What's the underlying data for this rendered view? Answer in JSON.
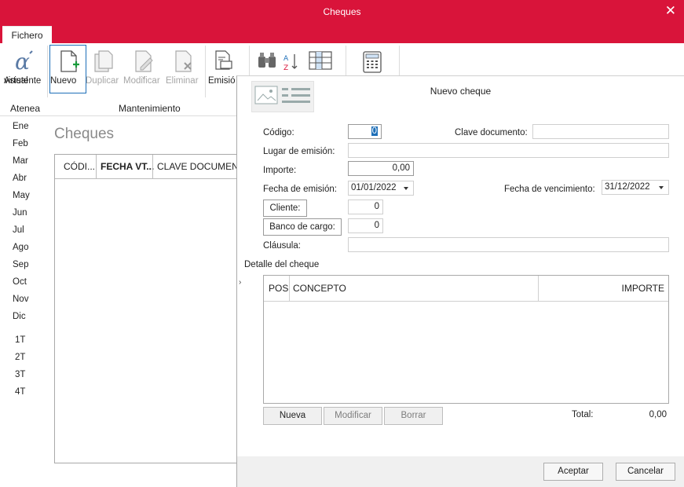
{
  "window": {
    "title": "Cheques",
    "close_glyph": "✕"
  },
  "tabs": [
    {
      "label": "Fichero"
    }
  ],
  "ribbon": {
    "asistente": {
      "line1": "Asistente",
      "line2": "virtual",
      "icon": "alpha-icon"
    },
    "nuevo": "Nuevo",
    "duplicar": "Duplicar",
    "modificar": "Modificar",
    "eliminar": "Eliminar",
    "emision": "Emisió",
    "group_atenea": "Atenea",
    "group_mantenimiento": "Mantenimiento"
  },
  "months": [
    "Ene",
    "Feb",
    "Mar",
    "Abr",
    "May",
    "Jun",
    "Jul",
    "Ago",
    "Sep",
    "Oct",
    "Nov",
    "Dic",
    "1T",
    "2T",
    "3T",
    "4T"
  ],
  "list": {
    "title": "Cheques",
    "columns": [
      "CÓDI...",
      "FECHA VT...",
      "CLAVE DOCUMENT"
    ]
  },
  "dialog": {
    "title": "Nuevo cheque",
    "codigo_label": "Código:",
    "codigo_value": "0",
    "clave_doc_label": "Clave documento:",
    "clave_doc_value": "",
    "lugar_label": "Lugar de emisión:",
    "lugar_value": "",
    "importe_label": "Importe:",
    "importe_value": "0,00",
    "fecha_emision_label": "Fecha de emisión:",
    "fecha_emision_value": "01/01/2022",
    "fecha_venc_label": "Fecha de vencimiento:",
    "fecha_venc_value": "31/12/2022",
    "cliente_label": "Cliente:",
    "cliente_value": "0",
    "banco_label": "Banco de cargo:",
    "banco_value": "0",
    "clausula_label": "Cláusula:",
    "clausula_value": "",
    "detalle_label": "Detalle del cheque",
    "detalle_columns": [
      "POS",
      "CONCEPTO",
      "IMPORTE"
    ],
    "btn_nueva": "Nueva",
    "btn_modificar": "Modificar",
    "btn_borrar": "Borrar",
    "total_label": "Total:",
    "total_value": "0,00",
    "btn_aceptar": "Aceptar",
    "btn_cancelar": "Cancelar"
  },
  "colors": {
    "accent": "#d9143a",
    "focus": "#1e6fb8"
  }
}
